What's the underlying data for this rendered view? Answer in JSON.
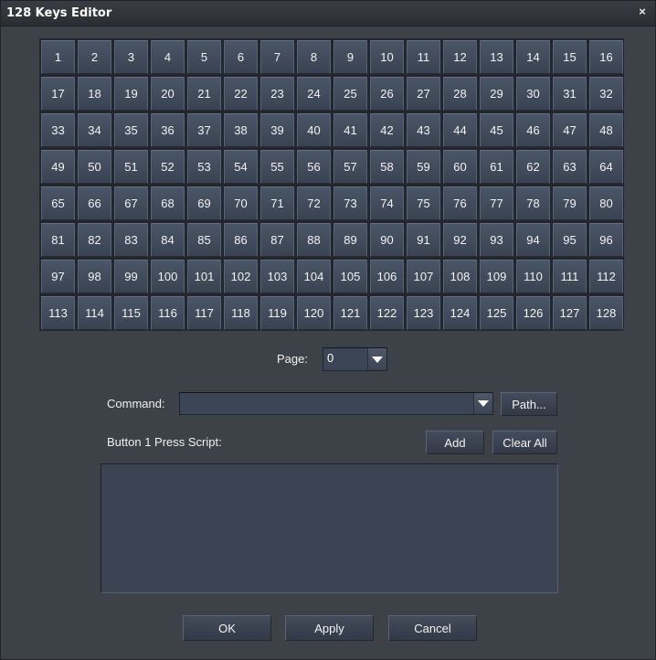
{
  "window": {
    "title": "128 Keys Editor",
    "close_glyph": "×"
  },
  "keys": [
    "1",
    "2",
    "3",
    "4",
    "5",
    "6",
    "7",
    "8",
    "9",
    "10",
    "11",
    "12",
    "13",
    "14",
    "15",
    "16",
    "17",
    "18",
    "19",
    "20",
    "21",
    "22",
    "23",
    "24",
    "25",
    "26",
    "27",
    "28",
    "29",
    "30",
    "31",
    "32",
    "33",
    "34",
    "35",
    "36",
    "37",
    "38",
    "39",
    "40",
    "41",
    "42",
    "43",
    "44",
    "45",
    "46",
    "47",
    "48",
    "49",
    "50",
    "51",
    "52",
    "53",
    "54",
    "55",
    "56",
    "57",
    "58",
    "59",
    "60",
    "61",
    "62",
    "63",
    "64",
    "65",
    "66",
    "67",
    "68",
    "69",
    "70",
    "71",
    "72",
    "73",
    "74",
    "75",
    "76",
    "77",
    "78",
    "79",
    "80",
    "81",
    "82",
    "83",
    "84",
    "85",
    "86",
    "87",
    "88",
    "89",
    "90",
    "91",
    "92",
    "93",
    "94",
    "95",
    "96",
    "97",
    "98",
    "99",
    "100",
    "101",
    "102",
    "103",
    "104",
    "105",
    "106",
    "107",
    "108",
    "109",
    "110",
    "111",
    "112",
    "113",
    "114",
    "115",
    "116",
    "117",
    "118",
    "119",
    "120",
    "121",
    "122",
    "123",
    "124",
    "125",
    "126",
    "127",
    "128"
  ],
  "page": {
    "label": "Page:",
    "value": "0"
  },
  "command": {
    "label": "Command:",
    "value": "",
    "path_button": "Path..."
  },
  "script": {
    "label": "Button 1 Press Script:",
    "add_button": "Add",
    "clear_button": "Clear All",
    "content": ""
  },
  "footer": {
    "ok": "OK",
    "apply": "Apply",
    "cancel": "Cancel"
  }
}
